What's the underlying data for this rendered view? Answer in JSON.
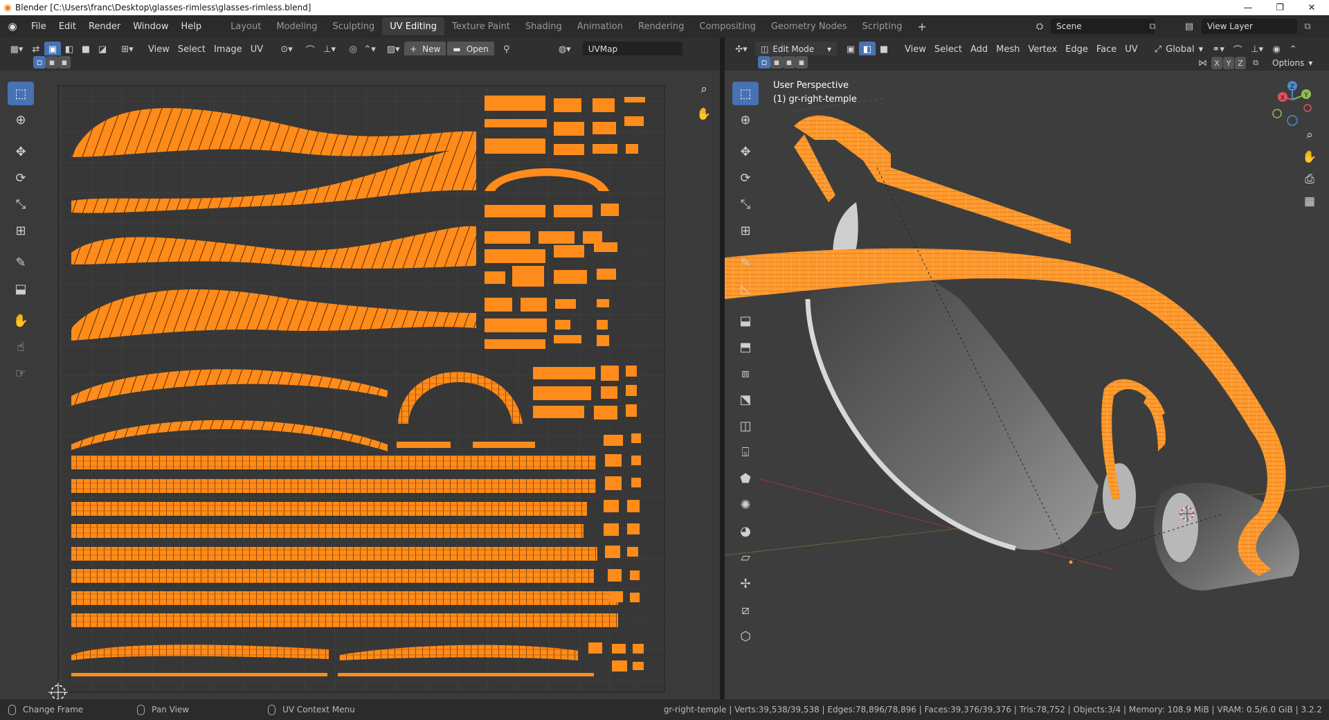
{
  "window": {
    "title": "Blender [C:\\Users\\franc\\Desktop\\glasses-rimless\\glasses-rimless.blend]",
    "controls": [
      "—",
      "❐",
      "✕"
    ]
  },
  "menu": [
    "File",
    "Edit",
    "Render",
    "Window",
    "Help"
  ],
  "workspaces": [
    {
      "label": "Layout"
    },
    {
      "label": "Modeling"
    },
    {
      "label": "Sculpting"
    },
    {
      "label": "UV Editing",
      "active": true
    },
    {
      "label": "Texture Paint"
    },
    {
      "label": "Shading"
    },
    {
      "label": "Animation"
    },
    {
      "label": "Rendering"
    },
    {
      "label": "Compositing"
    },
    {
      "label": "Geometry Nodes"
    },
    {
      "label": "Scripting"
    }
  ],
  "add_workspace": "+",
  "scene": {
    "label": "Scene"
  },
  "view_layer": {
    "label": "View Layer"
  },
  "uv_editor": {
    "menus": [
      "View",
      "Select",
      "Image",
      "UV"
    ],
    "new_label": "New",
    "open_label": "Open",
    "uvmap": "UVMap"
  },
  "viewport": {
    "mode": "Edit Mode",
    "menus": [
      "View",
      "Select",
      "Add",
      "Mesh",
      "Vertex",
      "Edge",
      "Face",
      "UV"
    ],
    "orientation": "Global",
    "axes": [
      "X",
      "Y",
      "Z"
    ],
    "options_label": "Options",
    "view_name": "User Perspective",
    "object_label": "(1) gr-right-temple",
    "gizmo": {
      "x": "X",
      "y": "Y",
      "z": "Z"
    }
  },
  "status": {
    "left": [
      {
        "label": "Change Frame"
      },
      {
        "label": "Pan View"
      },
      {
        "label": "UV Context Menu"
      }
    ],
    "stats": "gr-right-temple | Verts:39,538/39,538 | Edges:78,896/78,896 | Faces:39,376/39,376 | Tris:78,752 | Objects:3/4 | Memory: 108.9 MiB | VRAM: 0.5/6.0 GiB | 3.2.2"
  },
  "colors": {
    "accent": "#4772b3",
    "uv_island": "#ff8c1a",
    "app_bg": "#2b2b2b"
  }
}
